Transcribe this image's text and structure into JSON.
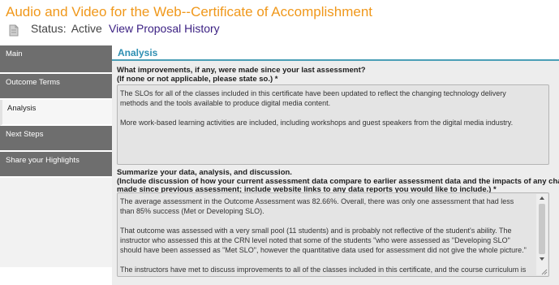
{
  "header": {
    "title": "Audio and Video for the Web--Certificate of Accomplishment",
    "status_label": "Status:",
    "status_value": "Active",
    "history_link": "View Proposal History"
  },
  "sidebar": {
    "items": [
      {
        "label": "Main"
      },
      {
        "label": "Outcome Terms"
      },
      {
        "label": "Analysis"
      },
      {
        "label": "Next Steps"
      },
      {
        "label": "Share your Highlights"
      }
    ],
    "active_index": 2
  },
  "section": {
    "heading": "Analysis"
  },
  "question1": {
    "line1": "What improvements, if any, were made since your last assessment?",
    "line2": "(If none or not applicable, please state so.) *",
    "answer": [
      "The SLOs for all of the classes included in this certificate have been updated to reflect the changing technology delivery methods and the tools available to produce digital media content.",
      "More work-based learning activities are included, including workshops and guest speakers from the digital media industry."
    ]
  },
  "question2": {
    "line1": "Summarize your data, analysis, and discussion.",
    "line2": "(Include discussion of how your current assessment data compare to earlier assessment data and the impacts of any changes",
    "line3": "made since previous assessment; include website links to any data reports you would like to include.) *",
    "answer": [
      "The average assessment in the Outcome Assessment was 82.66%. Overall, there was only one assessment that had less than 85% success (Met or Developing SLO).",
      "That outcome was assessed with a very small pool (11 students) and is probably not reflective of the student's ability. The instructor who assessed this at the CRN level noted that some of the students \"who were assessed as \"Developing SLO\" should have been assessed as \"Met SLO\", however the quantitative data used for assessment did not give the whole picture.\"",
      "The instructors have met to discuss improvements to all of the classes included in this certificate, and the course curriculum is"
    ]
  },
  "colors": {
    "title": "#f0981b",
    "link": "#3a1f82",
    "section_heading": "#2e8fb2",
    "sidebar_tab": "#6e6e6e"
  }
}
